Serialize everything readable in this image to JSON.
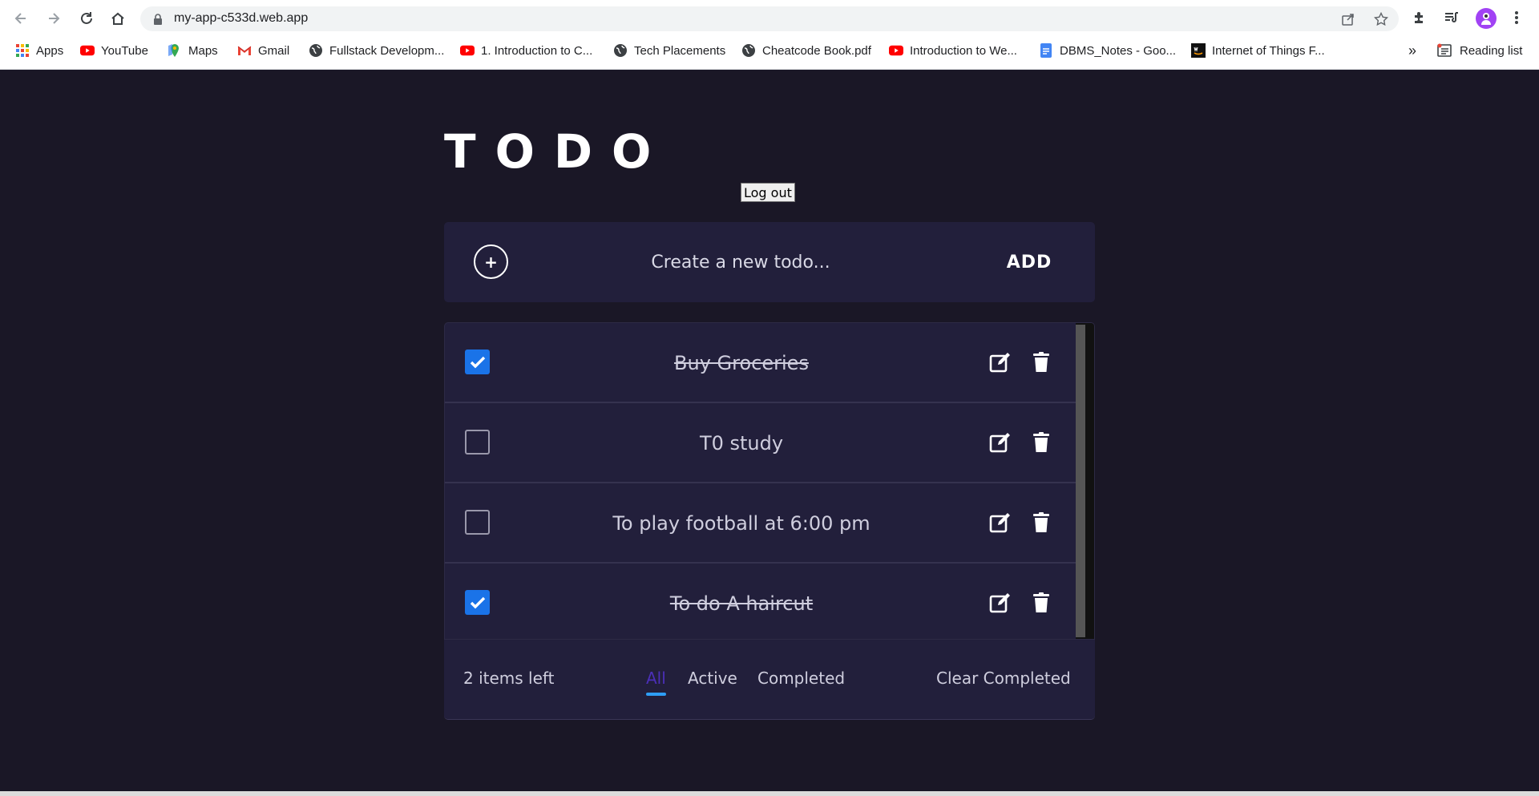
{
  "browser": {
    "url": "my-app-c533d.web.app",
    "bookmarks": [
      {
        "label": "Apps",
        "icon": "apps-grid-icon"
      },
      {
        "label": "YouTube",
        "icon": "youtube-icon"
      },
      {
        "label": "Maps",
        "icon": "maps-icon"
      },
      {
        "label": "Gmail",
        "icon": "gmail-icon"
      },
      {
        "label": "Fullstack Developm...",
        "icon": "globe-icon"
      },
      {
        "label": "1. Introduction to C...",
        "icon": "youtube-icon"
      },
      {
        "label": "Tech Placements",
        "icon": "globe-icon"
      },
      {
        "label": "Cheatcode Book.pdf",
        "icon": "globe-icon"
      },
      {
        "label": "Introduction to We...",
        "icon": "youtube-icon"
      },
      {
        "label": "DBMS_Notes - Goo...",
        "icon": "docs-icon"
      },
      {
        "label": "Internet of Things F...",
        "icon": "aws-icon"
      }
    ],
    "overflow_label": "»",
    "reading_list_label": "Reading list"
  },
  "app": {
    "title": "TODO",
    "logout_label": "Log out",
    "create_placeholder": "Create a new todo...",
    "add_label": "ADD",
    "todos": [
      {
        "text": "Buy Groceries",
        "completed": true
      },
      {
        "text": "T0 study",
        "completed": false
      },
      {
        "text": "To play football at 6:00 pm",
        "completed": false
      },
      {
        "text": "To do A haircut",
        "completed": true
      }
    ],
    "footer": {
      "items_left": "2 items left",
      "filters": {
        "all": "All",
        "active": "Active",
        "completed": "Completed"
      },
      "active_filter": "All",
      "clear_completed": "Clear Completed"
    }
  },
  "colors": {
    "background": "#1a1726",
    "card": "#221f3b",
    "checkbox_checked": "#1a73e8",
    "active_filter": "#4b2fb8",
    "filter_underline": "#2e9ef5"
  }
}
